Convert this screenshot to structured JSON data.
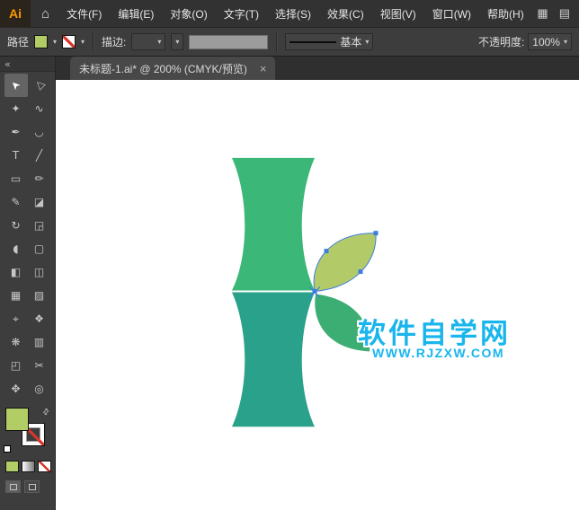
{
  "icons": {
    "home": "⌂",
    "grid": "▦",
    "panel": "▤",
    "caret": "▾",
    "swap": "⇄",
    "collapse": "«"
  },
  "menubar": {
    "logo": "Ai",
    "items": [
      "文件(F)",
      "编辑(E)",
      "对象(O)",
      "文字(T)",
      "选择(S)",
      "效果(C)",
      "视图(V)",
      "窗口(W)",
      "帮助(H)"
    ]
  },
  "controlbar": {
    "selection_type": "路径",
    "fill_color": "#b2cc66",
    "stroke_label": "描边:",
    "stroke_weight": "",
    "brush_definition": "基本",
    "opacity_label": "不透明度:",
    "opacity_value": "100%"
  },
  "tabbar": {
    "title": "未标题-1.ai* @ 200% (CMYK/预览)",
    "close": "×"
  },
  "toolbar": {
    "fill_color": "#b2cc66",
    "tools": [
      {
        "name": "selection",
        "glyph": "➤",
        "active": true
      },
      {
        "name": "direct-selection",
        "glyph": "▷",
        "active": false
      },
      {
        "name": "magic-wand",
        "glyph": "✦",
        "active": false
      },
      {
        "name": "lasso",
        "glyph": "∿",
        "active": false
      },
      {
        "name": "pen",
        "glyph": "✒",
        "active": false
      },
      {
        "name": "curvature",
        "glyph": "◡",
        "active": false
      },
      {
        "name": "type",
        "glyph": "T",
        "active": false
      },
      {
        "name": "line-segment",
        "glyph": "╱",
        "active": false
      },
      {
        "name": "rectangle",
        "glyph": "▭",
        "active": false
      },
      {
        "name": "paintbrush",
        "glyph": "✏",
        "active": false
      },
      {
        "name": "pencil",
        "glyph": "✎",
        "active": false
      },
      {
        "name": "eraser",
        "glyph": "◪",
        "active": false
      },
      {
        "name": "rotate",
        "glyph": "↻",
        "active": false
      },
      {
        "name": "scale",
        "glyph": "◲",
        "active": false
      },
      {
        "name": "width",
        "glyph": "◖",
        "active": false
      },
      {
        "name": "free-transform",
        "glyph": "▢",
        "active": false
      },
      {
        "name": "shape-builder",
        "glyph": "◧",
        "active": false
      },
      {
        "name": "perspective-grid",
        "glyph": "◫",
        "active": false
      },
      {
        "name": "mesh",
        "glyph": "▦",
        "active": false
      },
      {
        "name": "gradient",
        "glyph": "▨",
        "active": false
      },
      {
        "name": "eyedropper",
        "glyph": "⌖",
        "active": false
      },
      {
        "name": "blend",
        "glyph": "❖",
        "active": false
      },
      {
        "name": "symbol-sprayer",
        "glyph": "❋",
        "active": false
      },
      {
        "name": "column-graph",
        "glyph": "▥",
        "active": false
      },
      {
        "name": "artboard",
        "glyph": "◰",
        "active": false
      },
      {
        "name": "slice",
        "glyph": "✂",
        "active": false
      },
      {
        "name": "hand",
        "glyph": "✥",
        "active": false
      },
      {
        "name": "zoom",
        "glyph": "◎",
        "active": false
      }
    ]
  },
  "artwork": {
    "top_segment_color": "#3bb877",
    "bottom_segment_color": "#2aa18b",
    "selected_leaf_color": "#b2cb68",
    "lower_leaf_color": "#3cae73",
    "selection_color": "#3f7de0",
    "watermark_title": "软件自学网",
    "watermark_url": "WWW.RJZXW.COM",
    "watermark_color": "#19b5ec"
  }
}
